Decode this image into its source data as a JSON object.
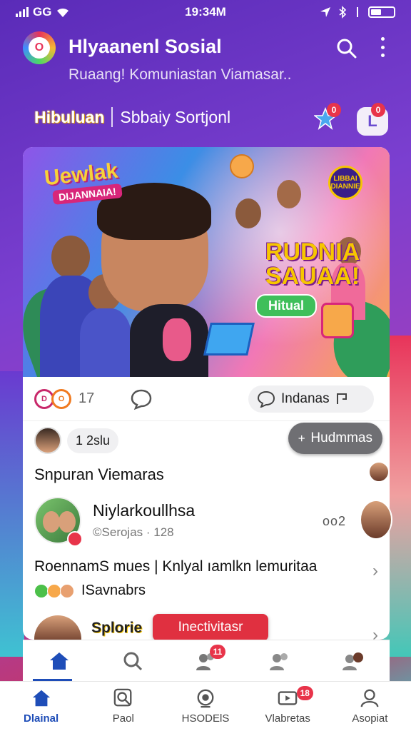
{
  "status_bar": {
    "network": "GG",
    "time": "19:34M"
  },
  "header": {
    "title": "Hlyaanenl Sosial",
    "subtitle": "Ruaang! Komuniastan Viamasar.."
  },
  "categories": {
    "active": "Hibuluan",
    "other": "Sbbaiy Sortjonl",
    "star_badge": "0",
    "notif_badge": "0",
    "notif_letter": "L"
  },
  "hero": {
    "title_left": "Uewlak",
    "sub_left": "DIJANNAIA!",
    "badge": "LIBBAI DIANNIE",
    "title_right": "RUDNIA SAUAA!",
    "pill": "Hitual"
  },
  "actions": {
    "reaction_count": "17",
    "share_label": "Indanas"
  },
  "comment": {
    "text": "1 2slu",
    "fab_label": "Hudmmas"
  },
  "feed": {
    "section_title": "Snpuran Viemaras",
    "user_name": "Niylarkoullhsa",
    "user_meta": "©Serojas · 128",
    "more": "oo2",
    "post_text": "RoennamS mues | Knlyal ıamlkn lemuritaa",
    "post_tags": "ISavnabrs",
    "next_label": "Splorie",
    "toast": "Inectivitasr"
  },
  "tabstrip": {
    "badge": "11"
  },
  "bottom_nav": [
    {
      "label": "Dlainal",
      "icon": "home-icon"
    },
    {
      "label": "Paol",
      "icon": "search-icon"
    },
    {
      "label": "HSODElS",
      "icon": "camera-icon"
    },
    {
      "label": "Vlabretas",
      "icon": "video-icon",
      "badge": "18"
    },
    {
      "label": "Asopiat",
      "icon": "profile-icon"
    }
  ],
  "colors": {
    "accent": "#1e4db8",
    "badge": "#e8344a",
    "fab": "#6f6f73",
    "toast": "#e03040"
  }
}
